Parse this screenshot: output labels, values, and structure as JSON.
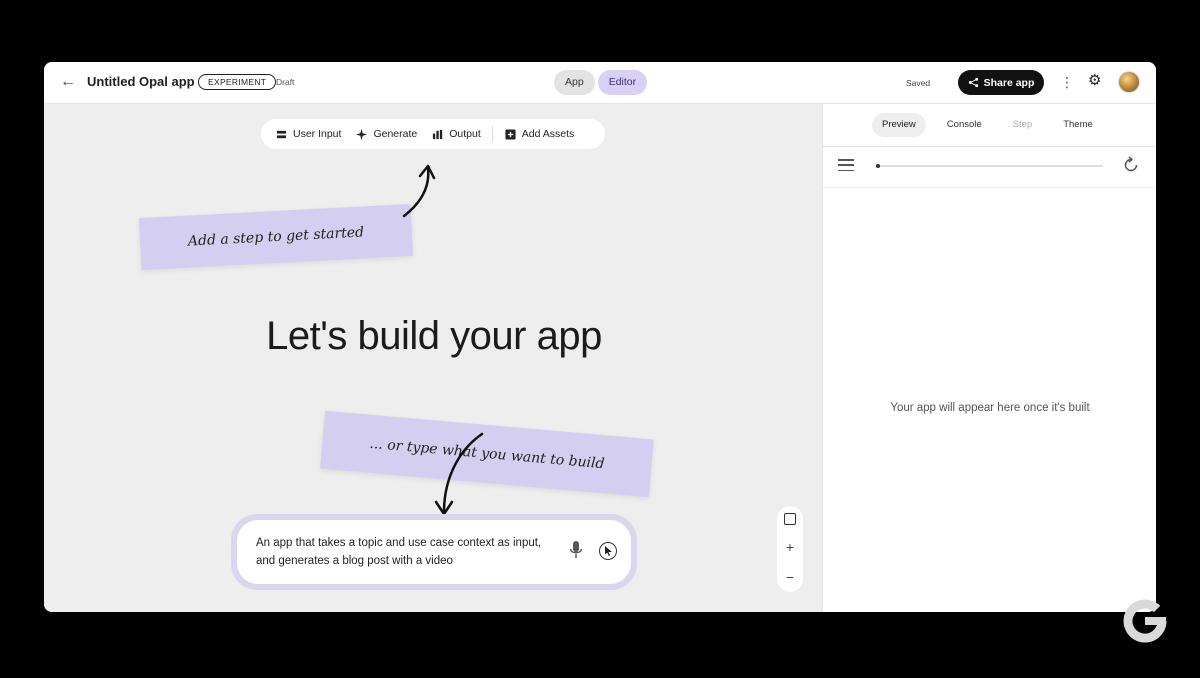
{
  "header": {
    "back_label": "←",
    "app_title": "Untitled Opal app",
    "badge": "EXPERIMENT",
    "status": "Draft",
    "toggles": [
      {
        "label": "App",
        "active": false
      },
      {
        "label": "Editor",
        "active": true
      }
    ],
    "saved_label": "Saved",
    "share_label": "Share app",
    "more_glyph": "⋮",
    "gear_glyph": "⚙"
  },
  "toolbar": {
    "items": [
      "User Input",
      "Generate",
      "Output",
      "Add Assets"
    ]
  },
  "canvas": {
    "note_top": "Add a step to get started",
    "title": "Let's build your app",
    "note_bottom": "... or type what you want to build",
    "prompt_text": "An app that takes a topic and use case context as input, and generates a blog post with a video",
    "zoom_in": "+",
    "zoom_out": "−"
  },
  "panel": {
    "tabs": [
      {
        "label": "Preview",
        "state": "active"
      },
      {
        "label": "Console",
        "state": "normal"
      },
      {
        "label": "Step",
        "state": "disabled"
      },
      {
        "label": "Theme",
        "state": "normal"
      }
    ],
    "empty_message": "Your app will appear here once it's built"
  },
  "colors": {
    "accent": "#d9d1f5",
    "note": "#d4cff0",
    "canvas_bg": "#eeeeee"
  }
}
